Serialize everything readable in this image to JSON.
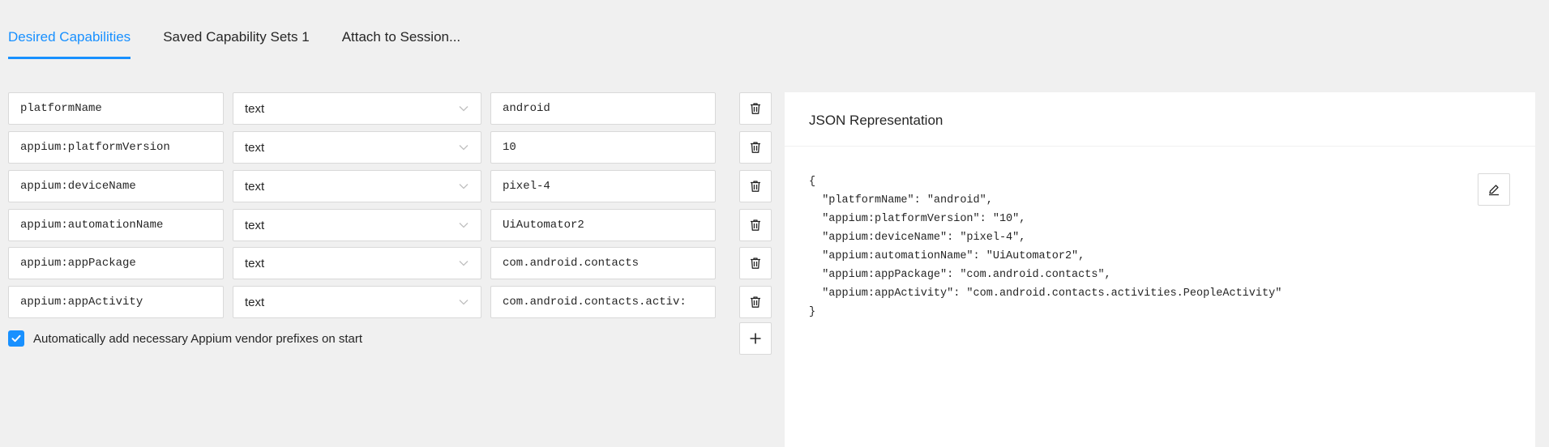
{
  "tabs": [
    {
      "label": "Desired Capabilities",
      "active": true
    },
    {
      "label": "Saved Capability Sets 1",
      "active": false
    },
    {
      "label": "Attach to Session...",
      "active": false
    }
  ],
  "capabilities": [
    {
      "name": "platformName",
      "type": "text",
      "value": "android"
    },
    {
      "name": "appium:platformVersion",
      "type": "text",
      "value": "10"
    },
    {
      "name": "appium:deviceName",
      "type": "text",
      "value": "pixel-4"
    },
    {
      "name": "appium:automationName",
      "type": "text",
      "value": "UiAutomator2"
    },
    {
      "name": "appium:appPackage",
      "type": "text",
      "value": "com.android.contacts"
    },
    {
      "name": "appium:appActivity",
      "type": "text",
      "value": "com.android.contacts.activ:"
    }
  ],
  "auto_prefix": {
    "label": "Automatically add necessary Appium vendor prefixes on start",
    "checked": true
  },
  "json_panel": {
    "title": "JSON Representation",
    "lines": [
      "{",
      "  \"platformName\": \"android\",",
      "  \"appium:platformVersion\": \"10\",",
      "  \"appium:deviceName\": \"pixel-4\",",
      "  \"appium:automationName\": \"UiAutomator2\",",
      "  \"appium:appPackage\": \"com.android.contacts\",",
      "  \"appium:appActivity\": \"com.android.contacts.activities.PeopleActivity\"",
      "}"
    ]
  },
  "colors": {
    "accent": "#1890ff",
    "background": "#f0f0f0",
    "border": "#d9d9d9"
  },
  "icons": {
    "delete": "trash-icon",
    "add": "plus-icon",
    "edit": "edit-icon",
    "select": "chevron-down-icon",
    "check": "check-icon"
  }
}
